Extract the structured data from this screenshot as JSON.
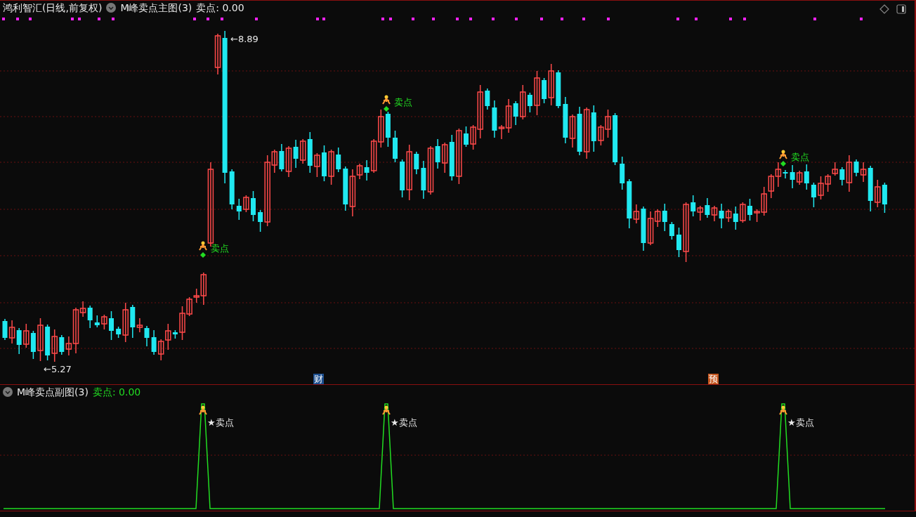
{
  "header": {
    "title": "鸿利智汇(日线,前复权)",
    "indicator": "M峰卖点主图(3)",
    "reading": "卖点: 0.00"
  },
  "main_chart": {
    "high_label": "←8.89",
    "low_label": "←5.27",
    "sell_signals": [
      {
        "label": "卖点"
      },
      {
        "label": "卖点"
      },
      {
        "label": "卖点"
      }
    ],
    "badges": [
      {
        "label": "财",
        "color": "#1d4f8f"
      },
      {
        "label": "预",
        "color": "#c4541c"
      }
    ]
  },
  "sub_chart": {
    "indicator": "M峰卖点副图(3)",
    "reading": "卖点: 0.00",
    "sell_signals": [
      {
        "label": "★卖点"
      },
      {
        "label": "★卖点"
      },
      {
        "label": "★卖点"
      }
    ]
  }
}
